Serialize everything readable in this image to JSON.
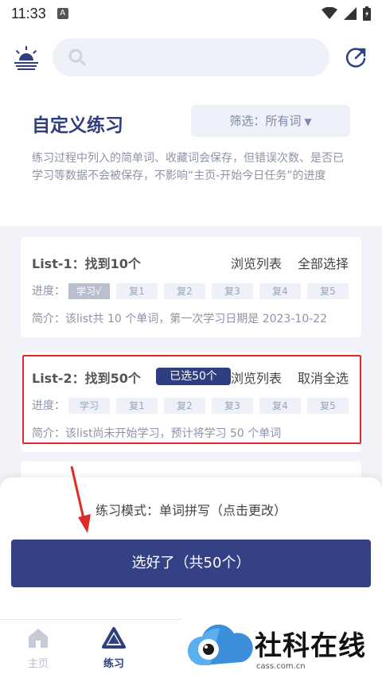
{
  "status_bar": {
    "time": "11:33",
    "notif_icon": "A"
  },
  "header": {
    "search_placeholder": ""
  },
  "page": {
    "title": "自定义练习",
    "filter_label": "筛选：所有词",
    "filter_caret": "▼",
    "description": "练习过程中列入的简单词、收藏词会保存，但错误次数、是否已学习等数据不会被保存，不影响“主页-开始今日任务”的进度"
  },
  "lists": [
    {
      "name": "List-1：找到10个",
      "badge": "",
      "browse": "浏览列表",
      "select": "全部选择",
      "progress_label": "进度：",
      "stages": [
        "学习√",
        "复1",
        "复2",
        "复3",
        "复4",
        "复5"
      ],
      "stages_done": 1,
      "summary": "简介：该list共 10 个单词，第一次学习日期是 2023-10-22"
    },
    {
      "name": "List-2：找到50个",
      "badge": "已选50个",
      "browse": "浏览列表",
      "select": "取消全选",
      "progress_label": "进度：",
      "stages": [
        "学习",
        "复1",
        "复2",
        "复3",
        "复4",
        "复5"
      ],
      "stages_done": 0,
      "summary": "简介：该list尚未开始学习，预计将学习 50 个单词"
    }
  ],
  "bottom": {
    "mode": "练习模式：单词拼写（点击更改）",
    "confirm": "选好了（共50个）"
  },
  "tabs": [
    {
      "label": "主页",
      "icon": "home-icon"
    },
    {
      "label": "练习",
      "icon": "practice-icon"
    }
  ],
  "watermark": {
    "text": "社科在线",
    "url": "cass.com.cn"
  },
  "colors": {
    "primary": "#344185",
    "highlight": "#e02a2a",
    "muted": "#8d93a8"
  }
}
